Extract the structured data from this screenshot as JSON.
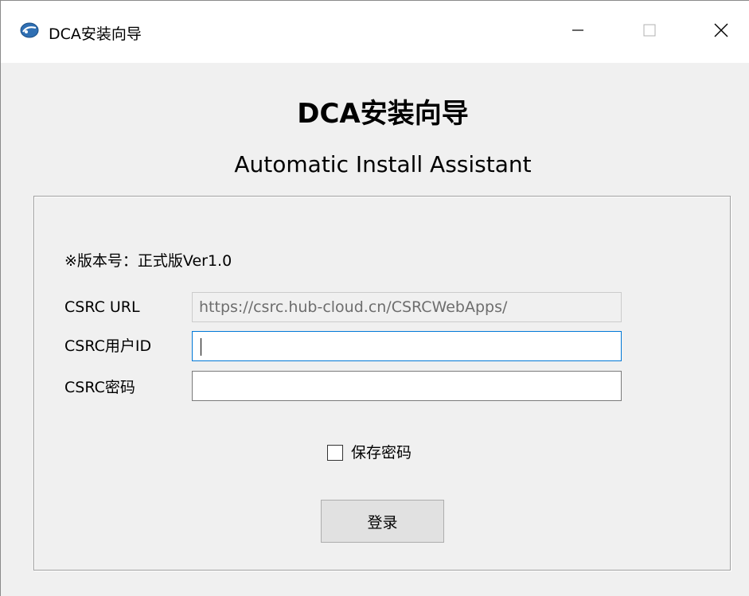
{
  "window": {
    "title": "DCA安装向导",
    "app_icon": "dca-logo-icon",
    "controls": {
      "minimize_icon": "minimize-icon",
      "maximize_icon": "maximize-icon",
      "close_icon": "close-icon"
    }
  },
  "header": {
    "title": "DCA安装向导",
    "subtitle": "Automatic Install Assistant"
  },
  "form": {
    "version_text": "※版本号：正式版Ver1.0",
    "url": {
      "label": "CSRC URL",
      "value": "https://csrc.hub-cloud.cn/CSRCWebApps/"
    },
    "user_id": {
      "label": "CSRC用户ID",
      "value": ""
    },
    "password": {
      "label": "CSRC密码",
      "value": ""
    },
    "save_password": {
      "label": "保存密码",
      "checked": false
    },
    "login_button": "登录"
  },
  "colors": {
    "focus_border": "#0078d7",
    "window_bg": "#f0f0f0",
    "titlebar_bg": "#ffffff",
    "logo_blue": "#2f6fb3"
  }
}
